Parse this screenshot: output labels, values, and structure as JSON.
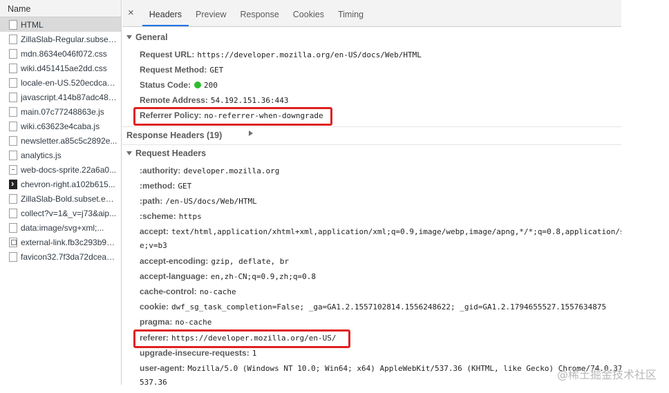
{
  "request_list": {
    "header": "Name",
    "items": [
      {
        "label": "HTML",
        "icon": "document-icon",
        "selected": true
      },
      {
        "label": "ZillaSlab-Regular.subset....",
        "icon": "document-icon"
      },
      {
        "label": "mdn.8634e046f072.css",
        "icon": "document-icon"
      },
      {
        "label": "wiki.d451415ae2dd.css",
        "icon": "document-icon"
      },
      {
        "label": "locale-en-US.520ecdcaef...",
        "icon": "document-icon"
      },
      {
        "label": "javascript.414b87adc480.js",
        "icon": "document-icon"
      },
      {
        "label": "main.07c77248863e.js",
        "icon": "document-icon"
      },
      {
        "label": "wiki.c63623e4caba.js",
        "icon": "document-icon"
      },
      {
        "label": "newsletter.a85c5c2892e...",
        "icon": "document-icon"
      },
      {
        "label": "analytics.js",
        "icon": "document-icon"
      },
      {
        "label": "web-docs-sprite.22a6a0...",
        "icon": "image-icon"
      },
      {
        "label": "chevron-right.a102b615...",
        "icon": "chevron-icon"
      },
      {
        "label": "ZillaSlab-Bold.subset.e96...",
        "icon": "document-icon"
      },
      {
        "label": "collect?v=1&_v=j73&aip...",
        "icon": "document-icon"
      },
      {
        "label": "data:image/svg+xml;...",
        "icon": "document-icon"
      },
      {
        "label": "external-link.fb3c293b92...",
        "icon": "external-link-icon"
      },
      {
        "label": "favicon32.7f3da72dcea1...",
        "icon": "document-icon"
      }
    ]
  },
  "tabs": {
    "close": "×",
    "items": [
      "Headers",
      "Preview",
      "Response",
      "Cookies",
      "Timing"
    ],
    "active": "Headers"
  },
  "general": {
    "title": "General",
    "request_url": {
      "key": "Request URL:",
      "value": "https://developer.mozilla.org/en-US/docs/Web/HTML"
    },
    "request_method": {
      "key": "Request Method:",
      "value": "GET"
    },
    "status_code": {
      "key": "Status Code:",
      "value": "200",
      "dot_color": "#2ebd2e"
    },
    "remote_address": {
      "key": "Remote Address:",
      "value": "54.192.151.36:443"
    },
    "referrer_policy": {
      "key": "Referrer Policy:",
      "value": "no-referrer-when-downgrade"
    }
  },
  "response_headers": {
    "title": "Response Headers (19)"
  },
  "request_headers": {
    "title": "Request Headers",
    "authority": {
      "key": ":authority:",
      "value": "developer.mozilla.org"
    },
    "method": {
      "key": ":method:",
      "value": "GET"
    },
    "path": {
      "key": ":path:",
      "value": "/en-US/docs/Web/HTML"
    },
    "scheme": {
      "key": ":scheme:",
      "value": "https"
    },
    "accept": {
      "key": "accept:",
      "value": "text/html,application/xhtml+xml,application/xml;q=0.9,image/webp,image/apng,*/*;q=0.8,application/s",
      "cont": "e;v=b3"
    },
    "accept_encoding": {
      "key": "accept-encoding:",
      "value": "gzip, deflate, br"
    },
    "accept_language": {
      "key": "accept-language:",
      "value": "en,zh-CN;q=0.9,zh;q=0.8"
    },
    "cache_control": {
      "key": "cache-control:",
      "value": "no-cache"
    },
    "cookie": {
      "key": "cookie:",
      "value": "dwf_sg_task_completion=False; _ga=GA1.2.1557102814.1556248622; _gid=GA1.2.1794655527.1557634875"
    },
    "pragma": {
      "key": "pragma:",
      "value": "no-cache"
    },
    "referer": {
      "key": "referer:",
      "value": "https://developer.mozilla.org/en-US/"
    },
    "upgrade": {
      "key": "upgrade-insecure-requests:",
      "value": "1"
    },
    "user_agent": {
      "key": "user-agent:",
      "value": "Mozilla/5.0 (Windows NT 10.0; Win64; x64) AppleWebKit/537.36 (KHTML, like Gecko) Chrome/74.0.37",
      "cont": "537.36"
    }
  },
  "highlight_color": "#e0201f",
  "watermark": "@稀土掘金技术社区"
}
